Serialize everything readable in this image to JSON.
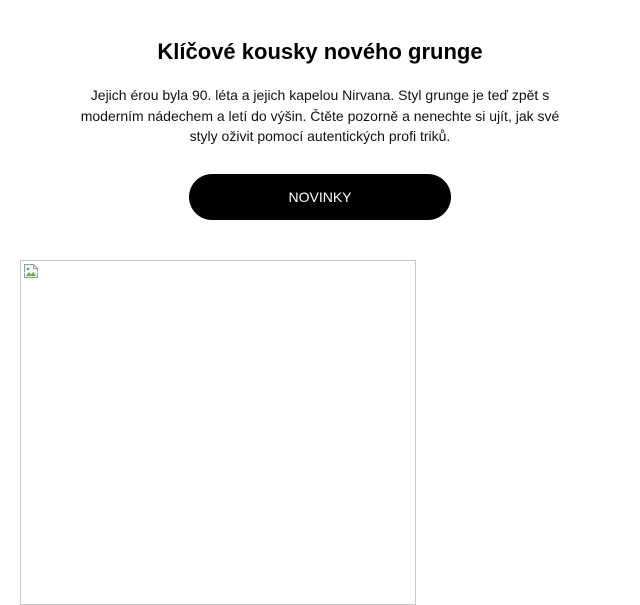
{
  "section": {
    "title": "Klíčové kousky nového grunge",
    "description": "Jejich érou byla 90. léta a jejich kapelou Nirvana. Styl grunge je teď zpět s moderním nádechem a letí do výšin. Čtěte pozorně a nenechte si ujít, jak své styly oživit pomocí autentických profi triků.",
    "cta_label": "NOVINKY"
  },
  "image": {
    "icon": "broken-image-icon"
  },
  "colors": {
    "button_background": "#000000",
    "button_text": "#ffffff",
    "text": "#111111",
    "image_border": "#c8c8c8"
  }
}
